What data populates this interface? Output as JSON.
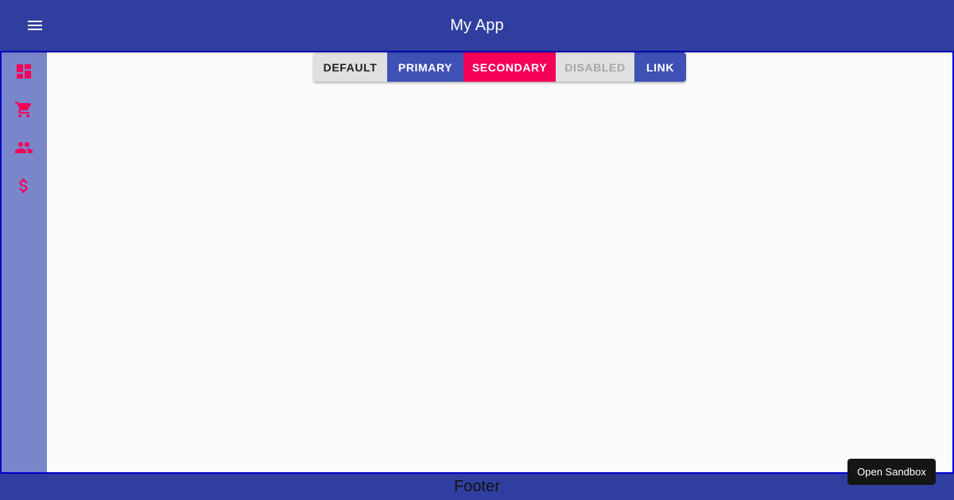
{
  "appbar": {
    "title": "My App",
    "menu_icon": "hamburger-menu-icon",
    "background": "#303f9f"
  },
  "sidebar": {
    "background": "#7986cb",
    "icon_color": "#f50057",
    "items": [
      {
        "icon": "dashboard-icon"
      },
      {
        "icon": "shopping-cart-icon"
      },
      {
        "icon": "people-icon"
      },
      {
        "icon": "dollar-icon"
      }
    ]
  },
  "buttons": {
    "default": "Default",
    "primary": "Primary",
    "secondary": "Secondary",
    "disabled": "Disabled",
    "link": "Link"
  },
  "colors": {
    "primary": "#3f51b5",
    "secondary": "#f50057",
    "default": "#e0e0e0"
  },
  "footer": {
    "text": "Footer"
  },
  "sandbox": {
    "label": "Open Sandbox"
  }
}
